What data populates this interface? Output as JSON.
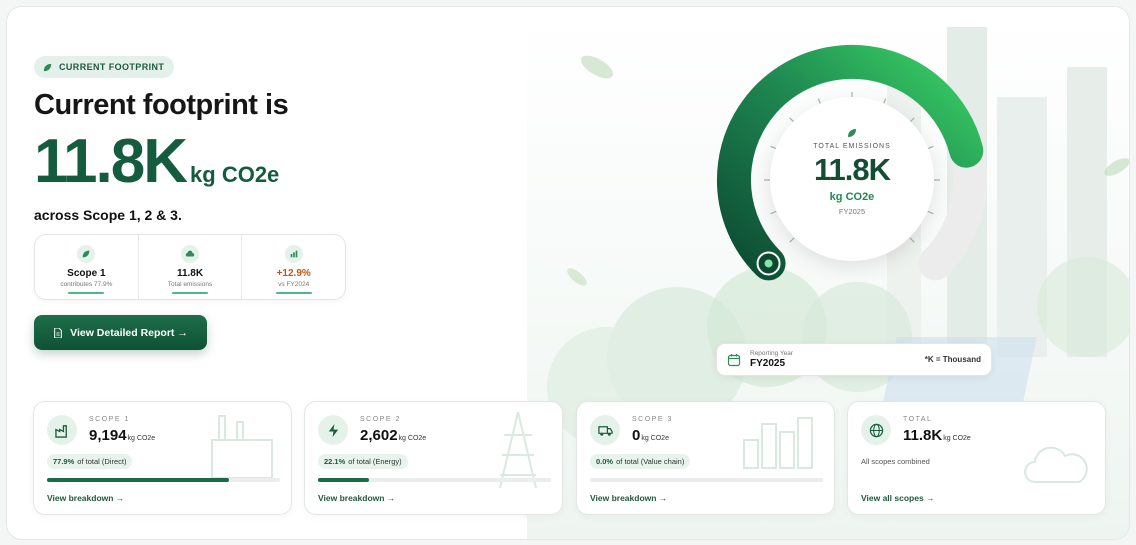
{
  "hero": {
    "pill": "CURRENT FOOTPRINT",
    "headline": "Current footprint is",
    "value": "11.8K",
    "unit": "kg CO2e",
    "scope_line": "across Scope 1, 2 & 3."
  },
  "stats": [
    {
      "value": "Scope 1",
      "sub": "contributes 77.9%",
      "icon": "leaf-icon"
    },
    {
      "value": "11.8K",
      "sub": "Total emissions",
      "icon": "cloud-icon"
    },
    {
      "value": "+12.9%",
      "sub": "vs FY2024",
      "icon": "chart-icon"
    }
  ],
  "report_button": "View Detailed Report →",
  "gauge": {
    "label": "TOTAL EMISSIONS",
    "value": "11.8K",
    "unit": "kg CO2e",
    "year": "FY2025",
    "fill_fraction": 0.78
  },
  "reporting": {
    "label": "Reporting Year",
    "value": "FY2025",
    "note": "*K = Thousand"
  },
  "scopes": [
    {
      "label": "SCOPE 1",
      "value": "9,194",
      "unit": "kg CO2e",
      "pct": "77.9%",
      "pct_text": "of total (Direct)",
      "fraction": 0.779,
      "link": "View breakdown →",
      "icon": "factory-icon"
    },
    {
      "label": "SCOPE 2",
      "value": "2,602",
      "unit": "kg CO2e",
      "pct": "22.1%",
      "pct_text": "of total (Energy)",
      "fraction": 0.221,
      "link": "View breakdown →",
      "icon": "lightning-icon"
    },
    {
      "label": "SCOPE 3",
      "value": "0",
      "unit": "kg CO2e",
      "pct": "0.0%",
      "pct_text": "of total (Value chain)",
      "fraction": 0.0,
      "link": "View breakdown →",
      "icon": "truck-icon"
    },
    {
      "label": "TOTAL",
      "value": "11.8K",
      "unit": "kg CO2e",
      "sub": "All scopes combined",
      "link": "View all scopes →",
      "icon": "globe-icon"
    }
  ],
  "colors": {
    "primary": "#145c3d",
    "accent": "#2fc15a",
    "warning": "#c25416"
  }
}
